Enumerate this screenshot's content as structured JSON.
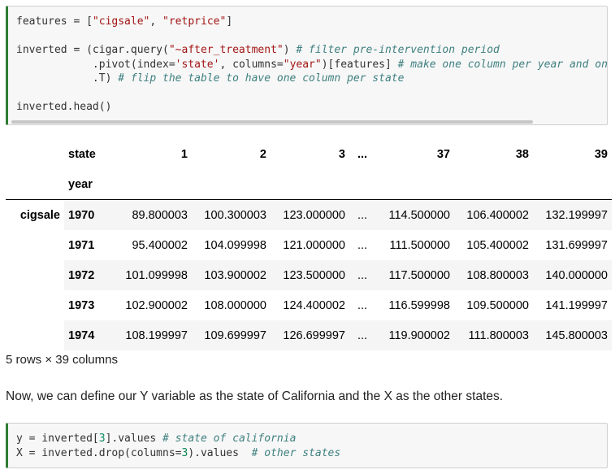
{
  "code_cell_1": {
    "line1_a": "features = [",
    "line1_s1": "\"cigsale\"",
    "line1_b": ", ",
    "line1_s2": "\"retprice\"",
    "line1_c": "]",
    "line3_a": "inverted = (cigar.query(",
    "line3_s": "\"~after_treatment\"",
    "line3_b": ") ",
    "line3_com": "# filter pre-intervention period",
    "line4_a": "            .pivot(index=",
    "line4_s1": "'state'",
    "line4_b": ", columns=",
    "line4_s2": "\"year\"",
    "line4_c": ")[features] ",
    "line4_com": "# make one column per year and one",
    "line5_a": "            .T) ",
    "line5_com": "# flip the table to have one column per state",
    "line7": "inverted.head()"
  },
  "table": {
    "header_state": "state",
    "header_year": "year",
    "columns": [
      "1",
      "2",
      "3",
      "...",
      "37",
      "38",
      "39"
    ],
    "group_label": "cigsale",
    "rows": [
      {
        "year": "1970",
        "values": [
          "89.800003",
          "100.300003",
          "123.000000",
          "...",
          "114.500000",
          "106.400002",
          "132.199997"
        ]
      },
      {
        "year": "1971",
        "values": [
          "95.400002",
          "104.099998",
          "121.000000",
          "...",
          "111.500000",
          "105.400002",
          "131.699997"
        ]
      },
      {
        "year": "1972",
        "values": [
          "101.099998",
          "103.900002",
          "123.500000",
          "...",
          "117.500000",
          "108.800003",
          "140.000000"
        ]
      },
      {
        "year": "1973",
        "values": [
          "102.900002",
          "108.000000",
          "124.400002",
          "...",
          "116.599998",
          "109.500000",
          "141.199997"
        ]
      },
      {
        "year": "1974",
        "values": [
          "108.199997",
          "109.699997",
          "126.699997",
          "...",
          "119.900002",
          "111.800003",
          "145.800003"
        ]
      }
    ]
  },
  "shape_note": "5 rows × 39 columns",
  "paragraph": "Now, we can define our Y variable as the state of California and the X as the other states.",
  "code_cell_2": {
    "line1_a": "y = inverted[",
    "line1_n": "3",
    "line1_b": "].values ",
    "line1_com": "# state of california",
    "line2_a": "X = inverted.drop(columns=",
    "line2_n": "3",
    "line2_b": ").values  ",
    "line2_com": "# other states"
  },
  "colors": {
    "cell_border_accent": "#2e7d32",
    "string": "#a31515",
    "comment": "#408080"
  }
}
